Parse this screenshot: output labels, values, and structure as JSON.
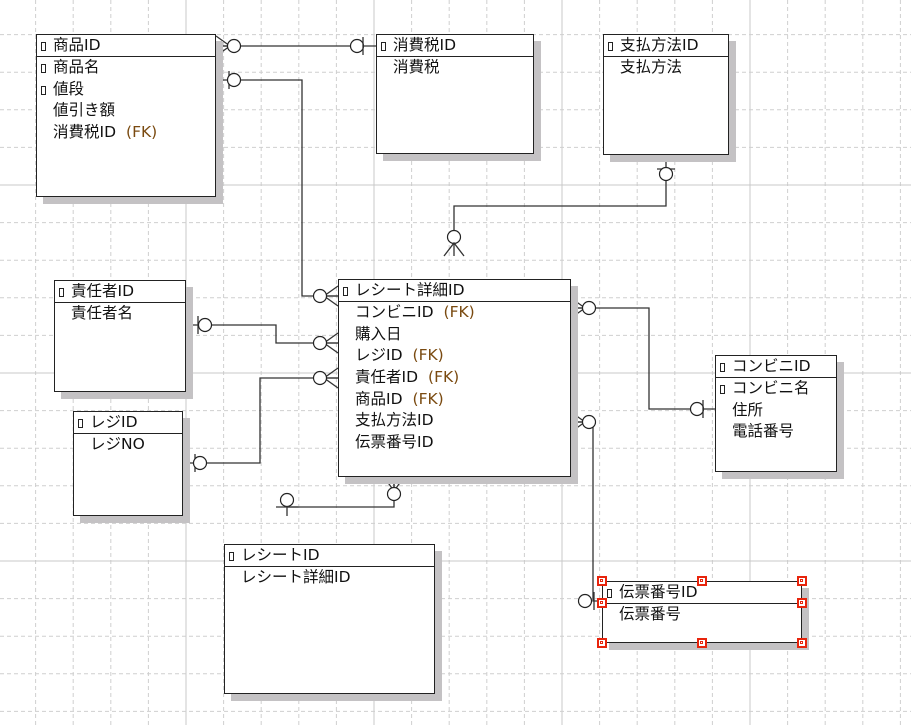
{
  "diagram": {
    "colors": {
      "fk_text": "#7a4a10",
      "selection": "#e8240c",
      "shadow": "#c4c2c4"
    },
    "entities": [
      {
        "id": "shohin",
        "pk": "商品ID",
        "attributes": [
          {
            "name": "商品名",
            "key": true
          },
          {
            "name": "値段",
            "key": true
          },
          {
            "name": "値引き額"
          },
          {
            "name": "消費税ID",
            "fk": "(FK)"
          }
        ]
      },
      {
        "id": "shohizei",
        "pk": "消費税ID",
        "attributes": [
          {
            "name": "消費税"
          }
        ]
      },
      {
        "id": "shiharai",
        "pk": "支払方法ID",
        "attributes": [
          {
            "name": "支払方法"
          }
        ]
      },
      {
        "id": "sekininsha",
        "pk": "責任者ID",
        "attributes": [
          {
            "name": "責任者名"
          }
        ]
      },
      {
        "id": "reji",
        "pk": "レジID",
        "attributes": [
          {
            "name": "レジNO"
          }
        ]
      },
      {
        "id": "receipt-detail",
        "pk": "レシート詳細ID",
        "attributes": [
          {
            "name": "コンビニID",
            "fk": "(FK)"
          },
          {
            "name": "購入日"
          },
          {
            "name": "レジID",
            "fk": "(FK)"
          },
          {
            "name": "責任者ID",
            "fk": "(FK)"
          },
          {
            "name": "商品ID",
            "fk": "(FK)"
          },
          {
            "name": "支払方法ID"
          },
          {
            "name": "伝票番号ID"
          }
        ]
      },
      {
        "id": "conveni",
        "pk": "コンビニID",
        "attributes": [
          {
            "name": "コンビニ名",
            "key": true
          },
          {
            "name": "住所"
          },
          {
            "name": "電話番号"
          }
        ]
      },
      {
        "id": "receipt",
        "pk": "レシートID",
        "attributes": [
          {
            "name": "レシート詳細ID"
          }
        ]
      },
      {
        "id": "denpyo",
        "pk": "伝票番号ID",
        "attributes": [
          {
            "name": "伝票番号"
          }
        ],
        "selected": true
      }
    ]
  }
}
